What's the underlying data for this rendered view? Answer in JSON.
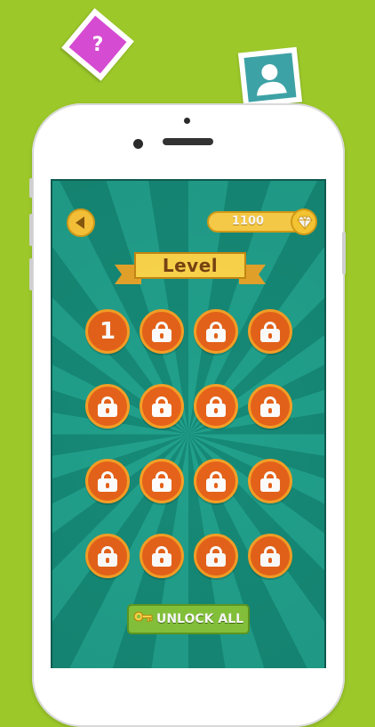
{
  "header": {
    "score": "1100",
    "title": "Level"
  },
  "levels": [
    {
      "label": "1",
      "state": "unlocked"
    },
    {
      "label": "",
      "state": "locked"
    },
    {
      "label": "",
      "state": "locked"
    },
    {
      "label": "",
      "state": "locked"
    },
    {
      "label": "",
      "state": "locked"
    },
    {
      "label": "",
      "state": "locked"
    },
    {
      "label": "",
      "state": "locked"
    },
    {
      "label": "",
      "state": "locked"
    },
    {
      "label": "",
      "state": "locked"
    },
    {
      "label": "",
      "state": "locked"
    },
    {
      "label": "",
      "state": "locked"
    },
    {
      "label": "",
      "state": "locked"
    },
    {
      "label": "",
      "state": "locked"
    },
    {
      "label": "",
      "state": "locked"
    },
    {
      "label": "",
      "state": "locked"
    },
    {
      "label": "",
      "state": "locked"
    }
  ],
  "footer": {
    "unlock_all_label": "UNLOCK ALL"
  },
  "decor": {
    "help_card_glyph": "?"
  },
  "icons": [
    "back-arrow-icon",
    "gem-icon",
    "lock-icon",
    "key-icon",
    "question-icon",
    "user-icon"
  ],
  "colors": {
    "background": "#9cc82a",
    "screen_teal": "#21a18c",
    "level_orange": "#e7631a",
    "level_ring": "#f7a126",
    "gold": "#ffd24a",
    "button_green": "#87c63b",
    "help_pink": "#d54bd1"
  }
}
